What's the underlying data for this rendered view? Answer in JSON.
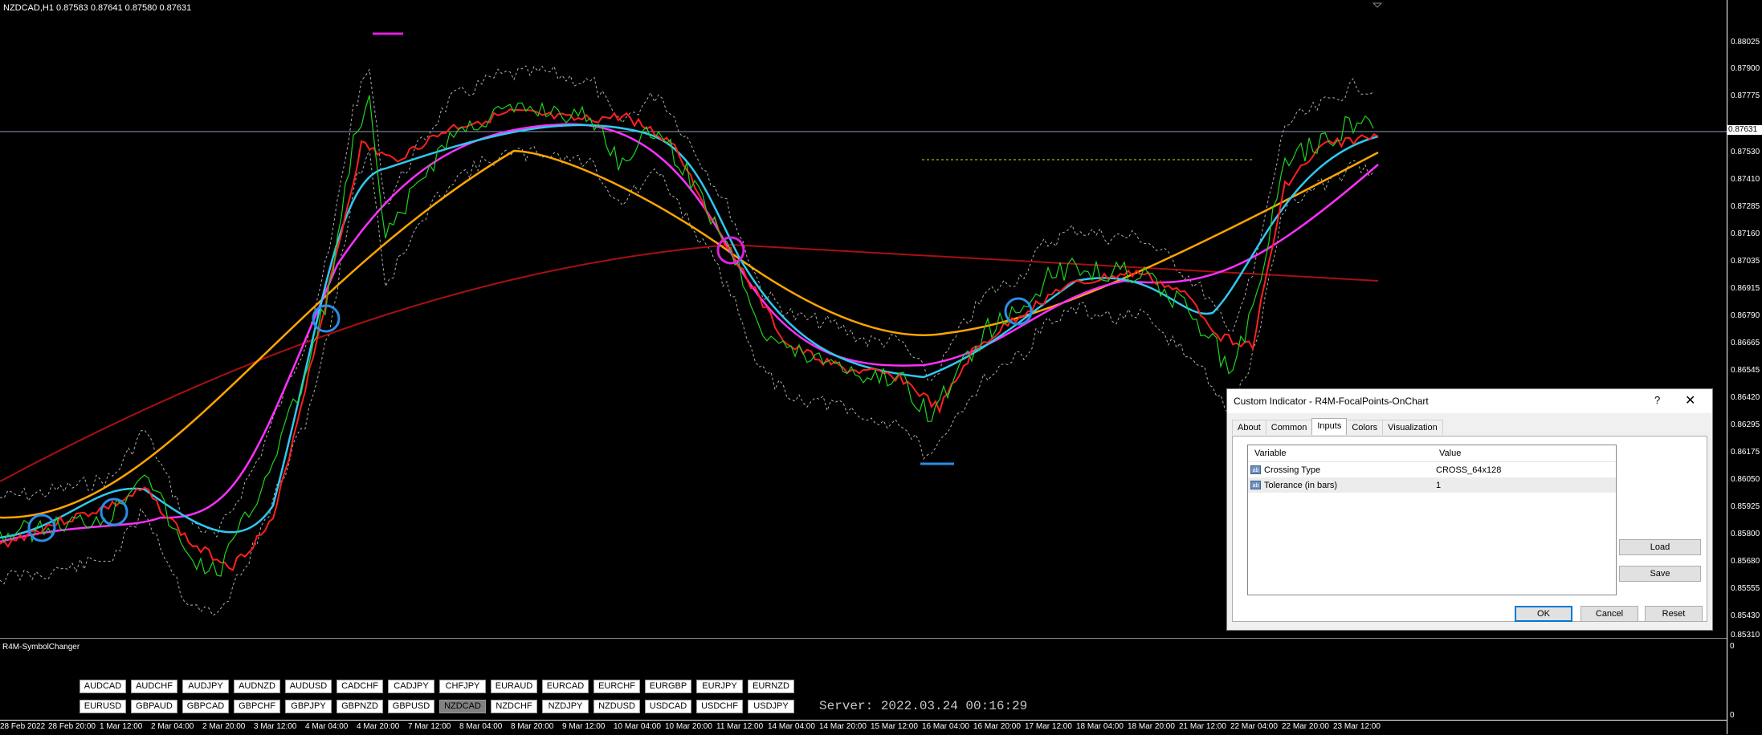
{
  "chart": {
    "title": "NZDCAD,H1  0.87583 0.87641 0.87580 0.87631",
    "current_price": "0.87631",
    "price_labels": [
      "0.88025",
      "0.87900",
      "0.87775",
      "0.87530",
      "0.87410",
      "0.87285",
      "0.87160",
      "0.87035",
      "0.86915",
      "0.86790",
      "0.86665",
      "0.86545",
      "0.86420",
      "0.86295",
      "0.86175",
      "0.86050",
      "0.85925",
      "0.85800",
      "0.85680",
      "0.85555",
      "0.85430",
      "0.85310"
    ],
    "time_labels": [
      "28 Feb 2022",
      "28 Feb 20:00",
      "1 Mar 12:00",
      "2 Mar 04:00",
      "2 Mar 20:00",
      "3 Mar 12:00",
      "4 Mar 04:00",
      "4 Mar 20:00",
      "7 Mar 12:00",
      "8 Mar 04:00",
      "8 Mar 20:00",
      "9 Mar 12:00",
      "10 Mar 04:00",
      "10 Mar 20:00",
      "11 Mar 12:00",
      "14 Mar 04:00",
      "14 Mar 20:00",
      "15 Mar 12:00",
      "16 Mar 04:00",
      "16 Mar 20:00",
      "17 Mar 12:00",
      "18 Mar 04:00",
      "18 Mar 20:00",
      "21 Mar 12:00",
      "22 Mar 04:00",
      "22 Mar 20:00",
      "23 Mar 12:00"
    ],
    "colors": {
      "price": "#1fd31f",
      "fast": "#ff2020",
      "cyan": "#30c8f0",
      "magenta": "#ff30ff",
      "slow": "#ffa500",
      "long": "#a81010",
      "channel": "#b0b0b0",
      "focal_blue": "#2a8ee8",
      "focal_magenta": "#e020e0"
    }
  },
  "subwindow": {
    "title": "R4M-SymbolChanger",
    "axis_top": "0",
    "axis_bottom": "0",
    "row1": [
      "AUDCAD",
      "AUDCHF",
      "AUDJPY",
      "AUDNZD",
      "AUDUSD",
      "CADCHF",
      "CADJPY",
      "CHFJPY",
      "EURAUD",
      "EURCAD",
      "EURCHF",
      "EURGBP",
      "EURJPY",
      "EURNZD"
    ],
    "row2": [
      "EURUSD",
      "GBPAUD",
      "GBPCAD",
      "GBPCHF",
      "GBPJPY",
      "GBPNZD",
      "GBPUSD",
      "NZDCAD",
      "NZDCHF",
      "NZDJPY",
      "NZDUSD",
      "USDCAD",
      "USDCHF",
      "USDJPY"
    ],
    "active_symbol": "NZDCAD",
    "server_time": "Server: 2022.03.24 00:16:29"
  },
  "dialog": {
    "title": "Custom Indicator - R4M-FocalPoints-OnChart",
    "help": "?",
    "close": "✕",
    "tabs": [
      "About",
      "Common",
      "Inputs",
      "Colors",
      "Visualization"
    ],
    "active_tab": "Inputs",
    "headers": {
      "variable": "Variable",
      "value": "Value"
    },
    "params": [
      {
        "icon": "ab",
        "variable": "Crossing Type",
        "value": "CROSS_64x128"
      },
      {
        "icon": "ab",
        "variable": "Tolerance (in bars)",
        "value": "1"
      }
    ],
    "buttons": {
      "load": "Load",
      "save": "Save",
      "ok": "OK",
      "cancel": "Cancel",
      "reset": "Reset"
    }
  }
}
